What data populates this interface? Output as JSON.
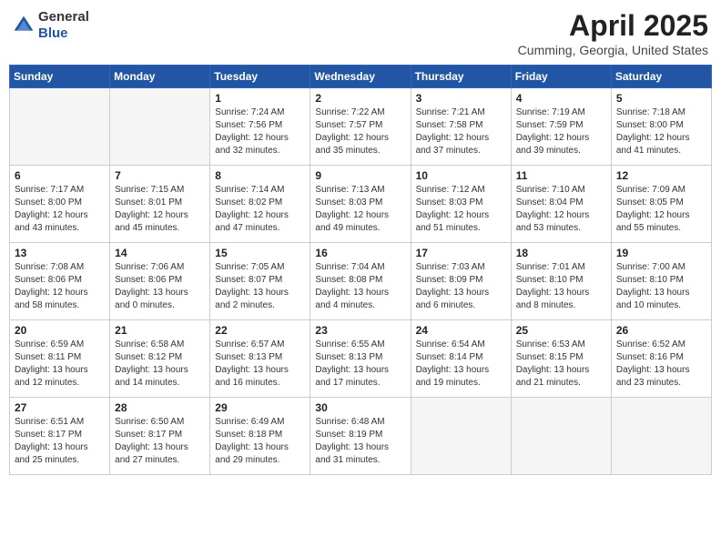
{
  "header": {
    "logo_line1": "General",
    "logo_line2": "Blue",
    "month": "April 2025",
    "location": "Cumming, Georgia, United States"
  },
  "days_of_week": [
    "Sunday",
    "Monday",
    "Tuesday",
    "Wednesday",
    "Thursday",
    "Friday",
    "Saturday"
  ],
  "weeks": [
    [
      {
        "day": "",
        "info": ""
      },
      {
        "day": "",
        "info": ""
      },
      {
        "day": "1",
        "info": "Sunrise: 7:24 AM\nSunset: 7:56 PM\nDaylight: 12 hours\nand 32 minutes."
      },
      {
        "day": "2",
        "info": "Sunrise: 7:22 AM\nSunset: 7:57 PM\nDaylight: 12 hours\nand 35 minutes."
      },
      {
        "day": "3",
        "info": "Sunrise: 7:21 AM\nSunset: 7:58 PM\nDaylight: 12 hours\nand 37 minutes."
      },
      {
        "day": "4",
        "info": "Sunrise: 7:19 AM\nSunset: 7:59 PM\nDaylight: 12 hours\nand 39 minutes."
      },
      {
        "day": "5",
        "info": "Sunrise: 7:18 AM\nSunset: 8:00 PM\nDaylight: 12 hours\nand 41 minutes."
      }
    ],
    [
      {
        "day": "6",
        "info": "Sunrise: 7:17 AM\nSunset: 8:00 PM\nDaylight: 12 hours\nand 43 minutes."
      },
      {
        "day": "7",
        "info": "Sunrise: 7:15 AM\nSunset: 8:01 PM\nDaylight: 12 hours\nand 45 minutes."
      },
      {
        "day": "8",
        "info": "Sunrise: 7:14 AM\nSunset: 8:02 PM\nDaylight: 12 hours\nand 47 minutes."
      },
      {
        "day": "9",
        "info": "Sunrise: 7:13 AM\nSunset: 8:03 PM\nDaylight: 12 hours\nand 49 minutes."
      },
      {
        "day": "10",
        "info": "Sunrise: 7:12 AM\nSunset: 8:03 PM\nDaylight: 12 hours\nand 51 minutes."
      },
      {
        "day": "11",
        "info": "Sunrise: 7:10 AM\nSunset: 8:04 PM\nDaylight: 12 hours\nand 53 minutes."
      },
      {
        "day": "12",
        "info": "Sunrise: 7:09 AM\nSunset: 8:05 PM\nDaylight: 12 hours\nand 55 minutes."
      }
    ],
    [
      {
        "day": "13",
        "info": "Sunrise: 7:08 AM\nSunset: 8:06 PM\nDaylight: 12 hours\nand 58 minutes."
      },
      {
        "day": "14",
        "info": "Sunrise: 7:06 AM\nSunset: 8:06 PM\nDaylight: 13 hours\nand 0 minutes."
      },
      {
        "day": "15",
        "info": "Sunrise: 7:05 AM\nSunset: 8:07 PM\nDaylight: 13 hours\nand 2 minutes."
      },
      {
        "day": "16",
        "info": "Sunrise: 7:04 AM\nSunset: 8:08 PM\nDaylight: 13 hours\nand 4 minutes."
      },
      {
        "day": "17",
        "info": "Sunrise: 7:03 AM\nSunset: 8:09 PM\nDaylight: 13 hours\nand 6 minutes."
      },
      {
        "day": "18",
        "info": "Sunrise: 7:01 AM\nSunset: 8:10 PM\nDaylight: 13 hours\nand 8 minutes."
      },
      {
        "day": "19",
        "info": "Sunrise: 7:00 AM\nSunset: 8:10 PM\nDaylight: 13 hours\nand 10 minutes."
      }
    ],
    [
      {
        "day": "20",
        "info": "Sunrise: 6:59 AM\nSunset: 8:11 PM\nDaylight: 13 hours\nand 12 minutes."
      },
      {
        "day": "21",
        "info": "Sunrise: 6:58 AM\nSunset: 8:12 PM\nDaylight: 13 hours\nand 14 minutes."
      },
      {
        "day": "22",
        "info": "Sunrise: 6:57 AM\nSunset: 8:13 PM\nDaylight: 13 hours\nand 16 minutes."
      },
      {
        "day": "23",
        "info": "Sunrise: 6:55 AM\nSunset: 8:13 PM\nDaylight: 13 hours\nand 17 minutes."
      },
      {
        "day": "24",
        "info": "Sunrise: 6:54 AM\nSunset: 8:14 PM\nDaylight: 13 hours\nand 19 minutes."
      },
      {
        "day": "25",
        "info": "Sunrise: 6:53 AM\nSunset: 8:15 PM\nDaylight: 13 hours\nand 21 minutes."
      },
      {
        "day": "26",
        "info": "Sunrise: 6:52 AM\nSunset: 8:16 PM\nDaylight: 13 hours\nand 23 minutes."
      }
    ],
    [
      {
        "day": "27",
        "info": "Sunrise: 6:51 AM\nSunset: 8:17 PM\nDaylight: 13 hours\nand 25 minutes."
      },
      {
        "day": "28",
        "info": "Sunrise: 6:50 AM\nSunset: 8:17 PM\nDaylight: 13 hours\nand 27 minutes."
      },
      {
        "day": "29",
        "info": "Sunrise: 6:49 AM\nSunset: 8:18 PM\nDaylight: 13 hours\nand 29 minutes."
      },
      {
        "day": "30",
        "info": "Sunrise: 6:48 AM\nSunset: 8:19 PM\nDaylight: 13 hours\nand 31 minutes."
      },
      {
        "day": "",
        "info": ""
      },
      {
        "day": "",
        "info": ""
      },
      {
        "day": "",
        "info": ""
      }
    ]
  ]
}
